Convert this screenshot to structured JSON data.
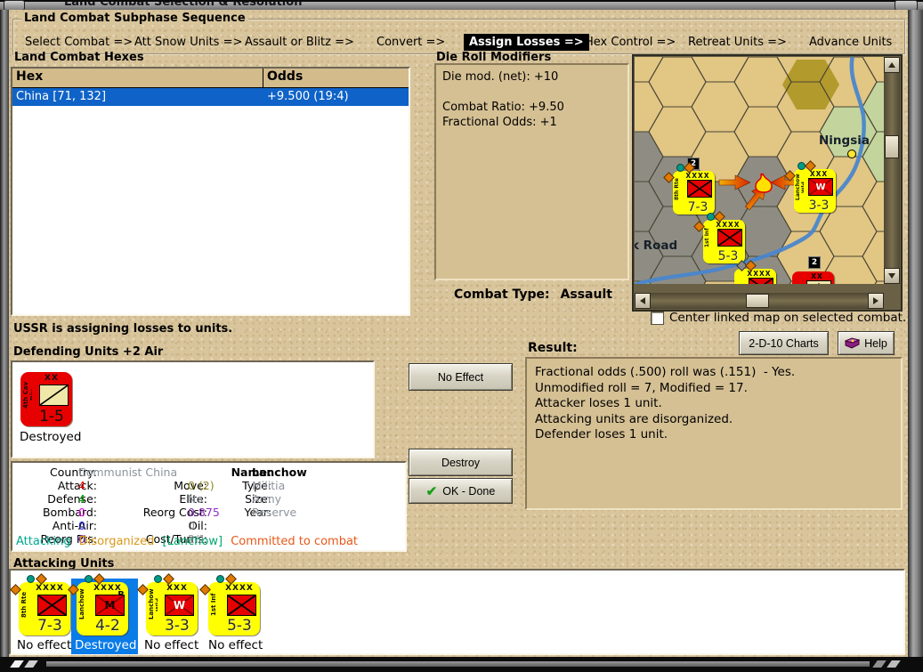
{
  "colors": {
    "selection": "#0f63c8",
    "selection-bright": "#0a7ce8",
    "counter-yellow": "#ffff00",
    "counter-red": "#e60000",
    "attack": "#e00000",
    "defense": "#009a00",
    "bombard": "#e000e0",
    "antiair": "#2222dd",
    "reorg": "#9030c0",
    "move": "#8f8820",
    "muted": "#8d949c",
    "status-attacking": "#00a890",
    "status-disorganized": "#d89818",
    "status-lanchow": "#00a870",
    "status-committed": "#e85818"
  },
  "window": {
    "title": "Land Combat Selection & Resolution"
  },
  "sequence": {
    "title": "Land Combat Subphase Sequence",
    "active_index": 4,
    "phases": [
      {
        "label": "Select Combat =>"
      },
      {
        "label": "Att Snow Units =>"
      },
      {
        "label": "Assault or Blitz =>"
      },
      {
        "label": "Convert =>"
      },
      {
        "label": "Assign Losses =>"
      },
      {
        "label": "Hex Control =>"
      },
      {
        "label": "Retreat Units =>"
      },
      {
        "label": "Advance Units"
      }
    ]
  },
  "combat_hexes": {
    "title": "Land Combat Hexes",
    "columns": [
      "Hex",
      "Odds"
    ],
    "rows": [
      {
        "hex": "China [71, 132]",
        "odds": "+9.500 (19:4)"
      }
    ]
  },
  "die_roll_modifiers": {
    "title": "Die Roll Modifiers",
    "lines": [
      "Die mod. (net): +10",
      "",
      "Combat Ratio: +9.50",
      "Fractional Odds: +1"
    ]
  },
  "combat_type": {
    "label": "Combat Type:",
    "value": "Assault"
  },
  "map": {
    "city": "Ningsia",
    "road": "k Road",
    "badges": [
      "2",
      "2"
    ],
    "checkbox_label": "Center linked map on selected combat.",
    "checked": false,
    "units": [
      {
        "side": "8th Rte",
        "size": "XXXX",
        "value": "7-3",
        "sym_letter": ""
      },
      {
        "side": "Lanchow Wld",
        "size": "XXX",
        "value": "3-3",
        "sym_letter": "W"
      },
      {
        "side": "1st Inf",
        "size": "XXXX",
        "value": "5-3",
        "sym_letter": ""
      },
      {
        "side": "",
        "size": "XXXX",
        "value": "",
        "sym_letter": ""
      },
      {
        "side": "",
        "size": "XX",
        "value": "",
        "sym_letter": ""
      }
    ]
  },
  "buttons": {
    "charts": "2-D-10 Charts",
    "help": "Help",
    "no_effect": "No Effect",
    "destroy": "Destroy",
    "ok_done": "OK - Done"
  },
  "status_line": "USSR is assigning losses to units.",
  "defending": {
    "title": "Defending Units +2 Air",
    "units": [
      {
        "side": "4th Cav Div",
        "size": "XX",
        "value": "1-5",
        "status": "Destroyed"
      }
    ]
  },
  "details": {
    "rows": [
      {
        "l1": "Country:",
        "v1": "Communist China",
        "l2": "",
        "v2": "",
        "l3": "Name:",
        "v3": "Lanchow"
      },
      {
        "l1": "Attack:",
        "v1": "4",
        "l2": "Move:",
        "v2": "0 (2)",
        "l3": "Type:",
        "v3": "Militia"
      },
      {
        "l1": "Defense:",
        "v1": "4",
        "l2": "Elite:",
        "v2": "No",
        "l3": "Size:",
        "v3": "Army"
      },
      {
        "l1": "Bombard:",
        "v1": "0",
        "l2": "Reorg Cost:",
        "v2": "0.875",
        "l3": "Year:",
        "v3": "Reserve"
      },
      {
        "l1": "Anti-Air:",
        "v1": "0",
        "l2": "Oil:",
        "v2": "0",
        "l3": "",
        "v3": ""
      },
      {
        "l1": "Reorg Pts:",
        "v1": "0",
        "l2": "Cost/Turns:",
        "v2": "2/1",
        "l3": "",
        "v3": ""
      }
    ],
    "status_parts": [
      "Attacking",
      "Disorganized",
      "[Lanchow]",
      "Committed to combat"
    ]
  },
  "result": {
    "title": "Result:",
    "lines": [
      "Fractional odds (.500) roll was (.151)  - Yes.",
      "Unmodified roll = 7, Modified = 17.",
      "Attacker loses 1 unit.",
      "Attacking units are disorganized.",
      "Defender loses 1 unit."
    ]
  },
  "attacking": {
    "title": "Attacking Units",
    "units": [
      {
        "side": "8th Rte",
        "size": "XXXX",
        "value": "7-3",
        "sym_letter": "",
        "corner": "",
        "status": "No effect"
      },
      {
        "side": "Lanchow",
        "size": "XXXX",
        "value": "4-2",
        "sym_letter": "M",
        "corner": "R",
        "status": "Destroyed"
      },
      {
        "side": "Lanchow Wld",
        "size": "XXX",
        "value": "3-3",
        "sym_letter": "W",
        "corner": "",
        "status": "No effect"
      },
      {
        "side": "1st Inf",
        "size": "XXXX",
        "value": "5-3",
        "sym_letter": "",
        "corner": "",
        "status": "No effect"
      }
    ]
  }
}
